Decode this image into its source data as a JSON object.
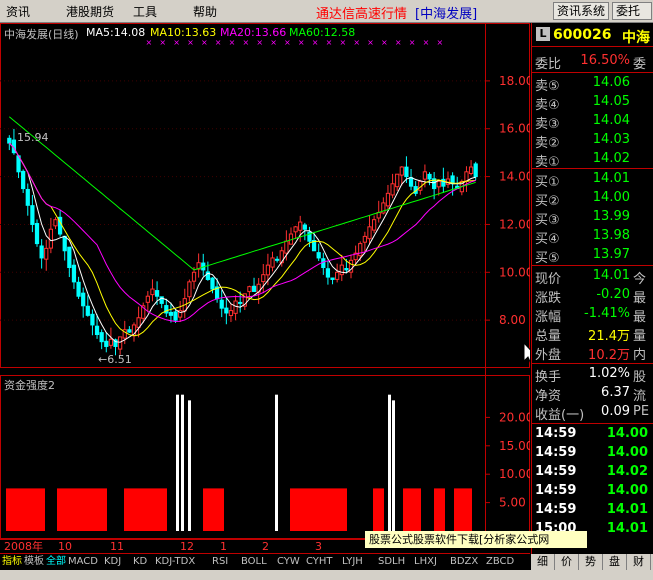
{
  "menu": {
    "items": [
      "资讯",
      "港股期货",
      "工具",
      "帮助"
    ],
    "title": "通达信高速行情",
    "title_stock": "[中海发展]",
    "buttons": [
      "资讯系统",
      "委托"
    ]
  },
  "header": {
    "stock_label": "中海发展(日线)",
    "ma5": "MA5:14.08",
    "ma10": "MA10:13.63",
    "ma20": "MA20:13.66",
    "ma60": "MA60:12.58",
    "ma_colors": {
      "ma5": "#ffffff",
      "ma10": "#ffff00",
      "ma20": "#ff00ff",
      "ma60": "#00ff00"
    }
  },
  "price_axis": {
    "labels": [
      "18.00",
      "16.00",
      "14.00",
      "12.00",
      "10.00",
      "8.00"
    ]
  },
  "annotations": {
    "high": "15.94",
    "low": "←6.51"
  },
  "indicator": {
    "title": "资金强度2",
    "axis_labels": [
      "20.00",
      "15.00",
      "10.00",
      "5.00"
    ]
  },
  "date_axis": {
    "labels": [
      "2008年",
      "10",
      "11",
      "12",
      "1",
      "2",
      "3"
    ]
  },
  "tabs": [
    "指标",
    "模板",
    "全部",
    "MACD",
    "KDJ",
    "KD",
    "KDJ-TDX",
    "RSI",
    "BOLL",
    "CYW",
    "CYHT",
    "LYJH",
    "SDLH",
    "LHXJ",
    "BDZX",
    "ZBCD"
  ],
  "promo": "股票公式股票软件下载[分析家公式网www.88gs.com]",
  "bottom_buttons": [
    "细",
    "价",
    "势",
    "盘",
    "财"
  ],
  "quote": {
    "code": "600026",
    "name": "中海",
    "weibi_label": "委比",
    "weibi_value": "16.50%",
    "weibi_ext": "委",
    "sells": [
      {
        "label": "卖⑤",
        "price": "14.06"
      },
      {
        "label": "卖④",
        "price": "14.05"
      },
      {
        "label": "卖③",
        "price": "14.04"
      },
      {
        "label": "卖②",
        "price": "14.03"
      },
      {
        "label": "卖①",
        "price": "14.02"
      }
    ],
    "buys": [
      {
        "label": "买①",
        "price": "14.01"
      },
      {
        "label": "买②",
        "price": "14.00"
      },
      {
        "label": "买③",
        "price": "13.99"
      },
      {
        "label": "买④",
        "price": "13.98"
      },
      {
        "label": "买⑤",
        "price": "13.97"
      }
    ],
    "stats": [
      {
        "label": "现价",
        "value": "14.01",
        "ext": "今",
        "color": "#00ff00"
      },
      {
        "label": "涨跌",
        "value": "-0.20",
        "ext": "最",
        "color": "#00ff00"
      },
      {
        "label": "涨幅",
        "value": "-1.41%",
        "ext": "最",
        "color": "#00ff00"
      },
      {
        "label": "总量",
        "value": "21.4万",
        "ext": "量",
        "color": "#ffff00"
      },
      {
        "label": "外盘",
        "value": "10.2万",
        "ext": "内",
        "color": "#ff3030"
      }
    ],
    "stats2": [
      {
        "label": "换手",
        "value": "1.02%",
        "ext": "股",
        "color": "#ffffff"
      },
      {
        "label": "净资",
        "value": "6.37",
        "ext": "流",
        "color": "#ffffff"
      },
      {
        "label": "收益(一)",
        "value": "0.09",
        "ext": "PE",
        "color": "#ffffff"
      }
    ],
    "ticks": [
      {
        "time": "14:59",
        "price": "14.00"
      },
      {
        "time": "14:59",
        "price": "14.00"
      },
      {
        "time": "14:59",
        "price": "14.02"
      },
      {
        "time": "14:59",
        "price": "14.00"
      },
      {
        "time": "14:59",
        "price": "14.01"
      },
      {
        "time": "15:00",
        "price": "14.01"
      }
    ]
  },
  "chart_data": {
    "type": "candlestick",
    "ylim": [
      6.0,
      19.5
    ],
    "closes": [
      15.4,
      15.0,
      14.2,
      13.5,
      12.8,
      12.0,
      11.2,
      10.6,
      11.0,
      11.8,
      12.2,
      11.6,
      10.9,
      10.2,
      9.6,
      9.0,
      8.6,
      8.2,
      7.8,
      7.4,
      7.1,
      6.9,
      7.2,
      6.9,
      7.3,
      7.6,
      7.5,
      7.8,
      8.1,
      8.6,
      9.0,
      9.3,
      9.0,
      8.7,
      8.3,
      8.2,
      8.0,
      8.4,
      8.9,
      9.6,
      10.0,
      10.4,
      10.1,
      9.7,
      9.3,
      8.9,
      8.5,
      8.3,
      8.4,
      8.8,
      8.7,
      9.1,
      9.4,
      9.2,
      9.5,
      9.9,
      10.3,
      10.6,
      10.5,
      10.9,
      11.3,
      11.6,
      11.9,
      12.1,
      11.8,
      11.3,
      10.9,
      10.6,
      10.2,
      9.8,
      9.7,
      10.0,
      10.3,
      10.1,
      10.5,
      10.8,
      11.2,
      11.5,
      11.9,
      12.2,
      12.5,
      12.9,
      13.3,
      13.7,
      14.1,
      14.4,
      14.0,
      13.6,
      13.3,
      13.8,
      14.2,
      13.9,
      13.5,
      13.8,
      13.6,
      13.9,
      13.7,
      13.5,
      13.8,
      14.2,
      14.4,
      14.0
    ]
  }
}
